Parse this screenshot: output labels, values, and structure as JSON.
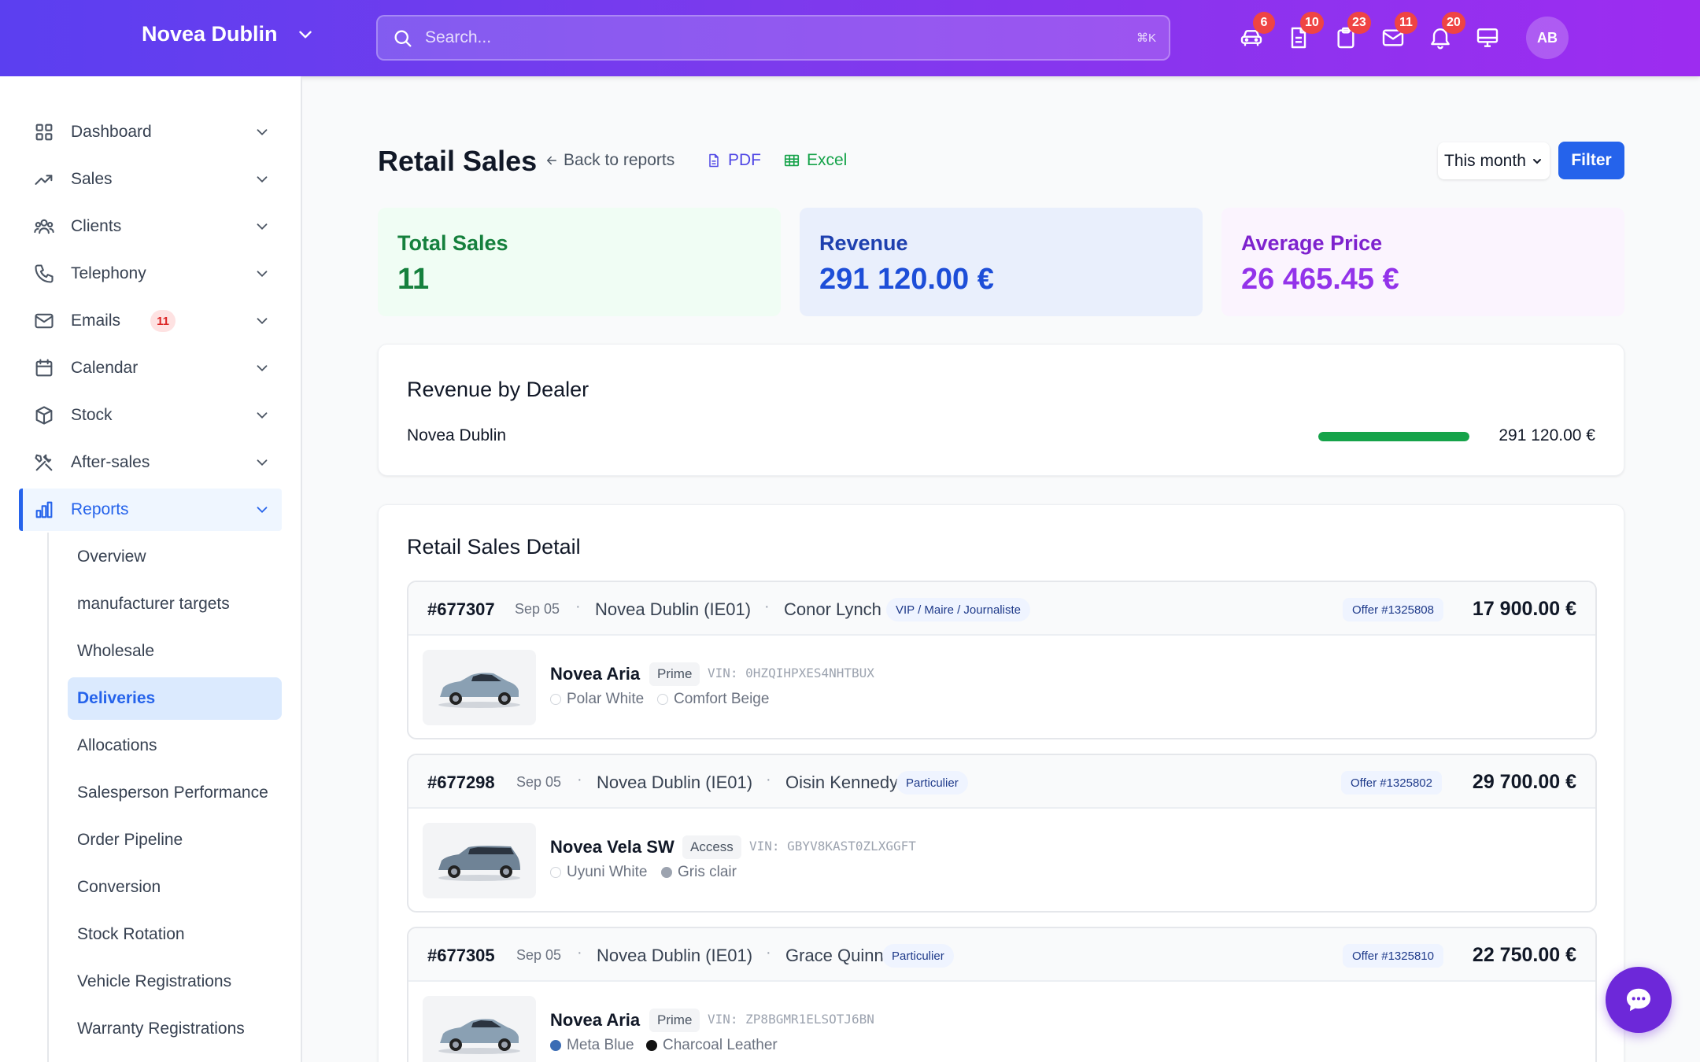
{
  "header": {
    "dealer": "Novea Dublin",
    "search_placeholder": "Search...",
    "search_shortcut": "⌘K",
    "icons": [
      {
        "name": "car-icon",
        "badge": "6"
      },
      {
        "name": "document-icon",
        "badge": "10"
      },
      {
        "name": "clipboard-icon",
        "badge": "23"
      },
      {
        "name": "mail-icon",
        "badge": "11"
      },
      {
        "name": "bell-icon",
        "badge": "20"
      },
      {
        "name": "monitor-icon",
        "badge": ""
      }
    ],
    "avatar_initials": "AB"
  },
  "sidebar": {
    "items": [
      {
        "label": "Dashboard",
        "icon": "grid-icon"
      },
      {
        "label": "Sales",
        "icon": "trend-icon"
      },
      {
        "label": "Clients",
        "icon": "users-icon"
      },
      {
        "label": "Telephony",
        "icon": "phone-icon"
      },
      {
        "label": "Emails",
        "icon": "mail-icon",
        "badge": "11"
      },
      {
        "label": "Calendar",
        "icon": "calendar-icon"
      },
      {
        "label": "Stock",
        "icon": "box-icon"
      },
      {
        "label": "After-sales",
        "icon": "tools-icon"
      },
      {
        "label": "Reports",
        "icon": "bar-chart-icon",
        "active": true
      }
    ],
    "sub_items": [
      {
        "label": "Overview"
      },
      {
        "label": "manufacturer targets"
      },
      {
        "label": "Wholesale"
      },
      {
        "label": "Deliveries",
        "active": true
      },
      {
        "label": "Allocations"
      },
      {
        "label": "Salesperson Performance"
      },
      {
        "label": "Order Pipeline"
      },
      {
        "label": "Conversion"
      },
      {
        "label": "Stock Rotation"
      },
      {
        "label": "Vehicle Registrations"
      },
      {
        "label": "Warranty Registrations"
      }
    ]
  },
  "main": {
    "title": "Retail Sales",
    "back_label": "Back to reports",
    "pdf_label": "PDF",
    "excel_label": "Excel",
    "period_value": "This month",
    "filter_label": "Filter",
    "stats": {
      "total_sales_label": "Total Sales",
      "total_sales_value": "11",
      "revenue_label": "Revenue",
      "revenue_value": "291 120.00 €",
      "avg_price_label": "Average Price",
      "avg_price_value": "26 465.45 €"
    },
    "revenue_by_dealer": {
      "title": "Revenue by Dealer",
      "rows": [
        {
          "dealer": "Novea Dublin",
          "amount": "291 120.00 €",
          "share": 1.0
        }
      ]
    },
    "detail": {
      "title": "Retail Sales Detail",
      "sales": [
        {
          "id": "#677307",
          "date": "Sep 05",
          "dealer": "Novea Dublin (IE01)",
          "client": "Conor Lynch",
          "tag": "VIP / Maire / Journaliste",
          "offer": "Offer #1325808",
          "price": "17 900.00 €",
          "model": "Novea Aria",
          "trim": "Prime",
          "vin": "VIN: 0HZQIHPXES4NHTBUX",
          "exterior": "Polar White",
          "exterior_color": "#ffffff",
          "interior": "Comfort Beige",
          "interior_color": "#ffffff",
          "body": "hatch"
        },
        {
          "id": "#677298",
          "date": "Sep 05",
          "dealer": "Novea Dublin (IE01)",
          "client": "Oisin Kennedy",
          "tag": "Particulier",
          "offer": "Offer #1325802",
          "price": "29 700.00 €",
          "model": "Novea Vela SW",
          "trim": "Access",
          "vin": "VIN: GBYV8KAST0ZLXGGFT",
          "exterior": "Uyuni White",
          "exterior_color": "#ffffff",
          "interior": "Gris clair",
          "interior_color": "#9ca3af",
          "body": "wagon"
        },
        {
          "id": "#677305",
          "date": "Sep 05",
          "dealer": "Novea Dublin (IE01)",
          "client": "Grace Quinn",
          "tag": "Particulier",
          "offer": "Offer #1325810",
          "price": "22 750.00 €",
          "model": "Novea Aria",
          "trim": "Prime",
          "vin": "VIN: ZP8BGMR1ELSOTJ6BN",
          "exterior": "Meta Blue",
          "exterior_color": "#3b6cb4",
          "interior": "Charcoal Leather",
          "interior_color": "#111111",
          "body": "hatch"
        }
      ]
    }
  },
  "colors": {
    "accent": "#2563eb",
    "header_start": "#5b3ff0",
    "header_end": "#9d2cf0",
    "chat": "#6d28d9"
  }
}
